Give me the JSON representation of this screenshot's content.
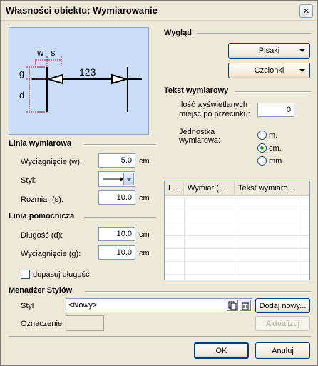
{
  "window": {
    "title": "Własności obiektu: Wymiarowanie",
    "close_glyph": "✕"
  },
  "preview": {
    "label_w": "w",
    "label_s": "s",
    "label_g": "g",
    "label_d": "d",
    "value": "123",
    "colors": {
      "background": "#c9ddf6",
      "dims": "#9b1b30",
      "lines": "#000000"
    }
  },
  "linia_wymiarowa": {
    "title": "Linia wymiarowa",
    "wyciagniecie": {
      "label": "Wyciągnięcie (w):",
      "value": "5.0",
      "unit": "cm"
    },
    "styl": {
      "label": "Styl:"
    },
    "rozmiar": {
      "label": "Rozmiar (s):",
      "value": "10.0",
      "unit": "cm"
    }
  },
  "linia_pomocnicza": {
    "title": "Linia pomocnicza",
    "dlugosc": {
      "label": "Długość (d):",
      "value": "10.0",
      "unit": "cm"
    },
    "wyciagniecie": {
      "label": "Wyciągnięcie (g):",
      "value": "10.0",
      "unit": "cm"
    },
    "dopasuj": {
      "label": "dopasuj długość",
      "checked": false
    }
  },
  "wyglad": {
    "title": "Wygląd",
    "pisaki": "Pisaki",
    "czcionki": "Czcionki"
  },
  "tekst": {
    "title": "Tekst wymiarowy",
    "ilosc_label_1": "Ilość wyświetlanych",
    "ilosc_label_2": "miejsc po przecinku:",
    "ilosc_value": "0",
    "jednostka_label_1": "Jednostka",
    "jednostka_label_2": "wymiarowa:",
    "units": [
      {
        "label": "m.",
        "selected": false
      },
      {
        "label": "cm.",
        "selected": true
      },
      {
        "label": "mm.",
        "selected": false
      }
    ]
  },
  "table": {
    "columns": [
      "L...",
      "Wymiar (...",
      "Tekst wymiaro..."
    ]
  },
  "menadzer": {
    "title": "Menadżer Stylów",
    "styl_label": "Styl",
    "styl_value": "<Nowy>",
    "dodaj": "Dodaj nowy...",
    "oznaczenie_label": "Oznaczenie",
    "aktualizuj": "Aktualizuj"
  },
  "buttons": {
    "ok": "OK",
    "anuluj": "Anuluj"
  }
}
